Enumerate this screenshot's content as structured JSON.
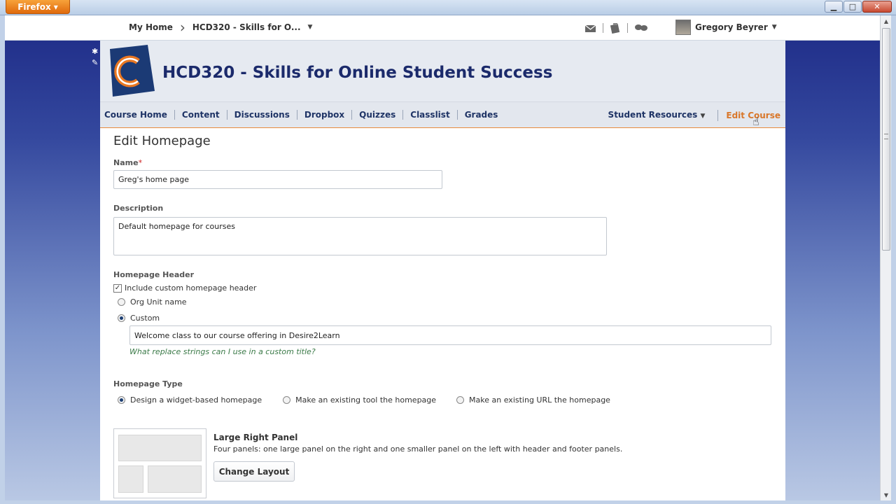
{
  "browser": {
    "app_button": "Firefox",
    "controls": {
      "minimize": "▁",
      "maximize": "□",
      "close": "✕"
    }
  },
  "topbar": {
    "breadcrumb": {
      "home": "My Home",
      "course": "HCD320 - Skills for O..."
    },
    "user_name": "Gregory Beyrer"
  },
  "course": {
    "title": "HCD320 - Skills for Online Student Success",
    "nav": [
      "Course Home",
      "Content",
      "Discussions",
      "Dropbox",
      "Quizzes",
      "Classlist",
      "Grades"
    ],
    "student_resources": "Student Resources",
    "edit_course": "Edit Course"
  },
  "form": {
    "page_title": "Edit Homepage",
    "name_label": "Name",
    "required_marker": "*",
    "name_value": "Greg's home page",
    "description_label": "Description",
    "description_value": "Default homepage for courses",
    "header_section_label": "Homepage Header",
    "include_header_label": "Include custom homepage header",
    "include_header_checked": true,
    "org_unit_label": "Org Unit name",
    "custom_label": "Custom",
    "custom_value": "Welcome class to our course offering in Desire2Learn",
    "replace_strings_link": "What replace strings can I use in a custom title?",
    "type_section_label": "Homepage Type",
    "type_options": [
      "Design a widget-based homepage",
      "Make an existing tool the homepage",
      "Make an existing URL the homepage"
    ],
    "type_selected": "Design a widget-based homepage",
    "layout_name": "Large Right Panel",
    "layout_description": "Four panels: one large panel on the right and one smaller panel on the left with header and footer panels.",
    "change_layout_button": "Change Layout"
  },
  "colors": {
    "accent_orange": "#d9772a",
    "nav_text": "#1f3466",
    "title_navy": "#1b2a6b",
    "help_green": "#3b7a48"
  }
}
